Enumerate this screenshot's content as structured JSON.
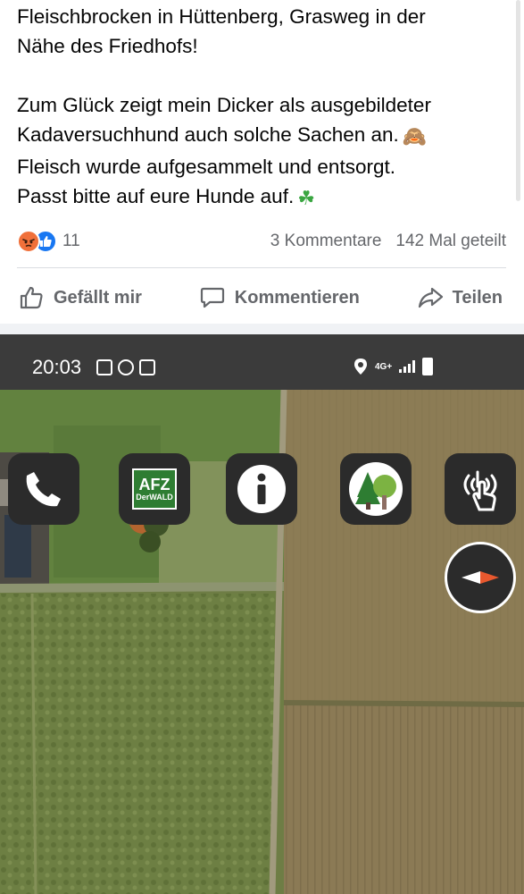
{
  "post": {
    "lines_1": [
      "Fleischbrocken in Hüttenberg, Grasweg in der",
      "Nähe des Friedhofs!"
    ],
    "lines_2": [
      "Zum Glück zeigt mein Dicker als ausgebildeter",
      "Kadaversuchhund auch solche Sachen an.",
      "Fleisch wurde aufgesammelt und entsorgt.",
      "Passt bitte auf eure Hunde auf."
    ],
    "emoji_monkey": "🙈",
    "emoji_clover": "☘"
  },
  "engagement": {
    "reaction_count": "11",
    "comments": "3 Kommentare",
    "shares": "142 Mal geteilt"
  },
  "actions": {
    "like": "Gefällt mir",
    "comment": "Kommentieren",
    "share": "Teilen"
  },
  "screenshot": {
    "time": "20:03",
    "network": "4G+",
    "buttons": [
      {
        "name": "phone-icon"
      },
      {
        "name": "afz-logo",
        "title": "AFZ",
        "subtitle": "DerWALD"
      },
      {
        "name": "info-icon"
      },
      {
        "name": "tree-icon"
      },
      {
        "name": "radio-touch-icon"
      }
    ]
  },
  "colors": {
    "facebook_blue": "#1877f2",
    "angry_orange": "#f0703a",
    "muted_text": "#65676b",
    "location_blue": "#1e7fd8"
  }
}
